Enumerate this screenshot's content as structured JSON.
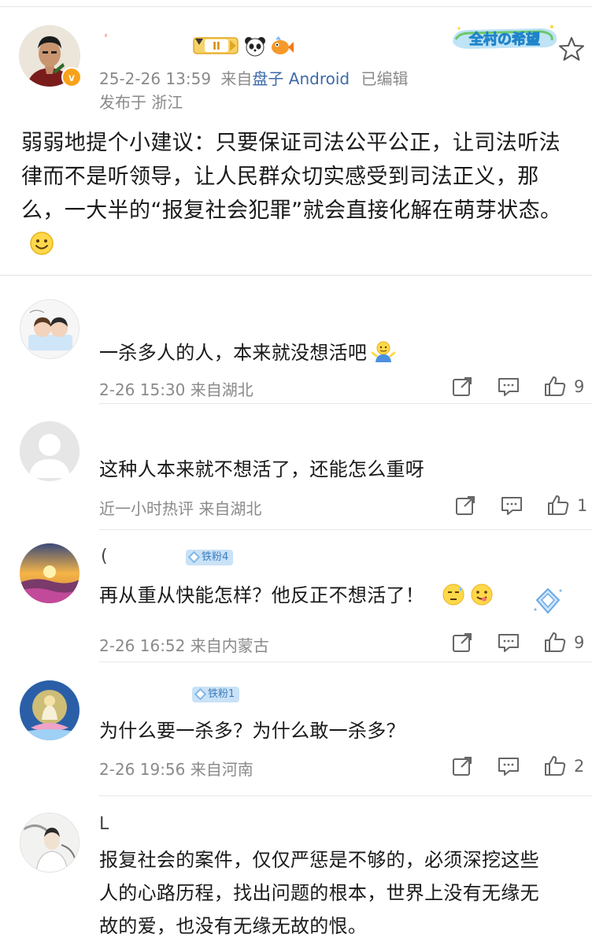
{
  "post": {
    "time": "25-2-26 13:59",
    "source_prefix": "来自",
    "source_app": "盘子 Android",
    "edited": "已编辑",
    "location": "发布于 浙江",
    "level_badge": "II",
    "brand_logo_text": "全村の希望",
    "text": "弱弱地提个小建议：只要保证司法公平公正，让司法听法律而不是听领导，让人民群众切实感受到司法正义，那么，一大半的“报复社会犯罪”就会直接化解在萌芽状态。",
    "emoji": "smile-emoji"
  },
  "comments": [
    {
      "text": "一杀多人的人，本来就没想活吧",
      "meta": "2-26 15:30  来自湖北",
      "likes": "9",
      "emoji": "shrug-emoji",
      "avatar": "cartoon-couple-avatar"
    },
    {
      "text": "这种人本来就不想活了，还能怎么重呀",
      "meta": "近一小时热评  来自湖北",
      "likes": "1",
      "avatar": "default-avatar"
    },
    {
      "name_mark": "(",
      "badge": "铁粉4",
      "text": "再从重从快能怎样？他反正不想活了！",
      "meta": "2-26 16:52  来自内蒙古",
      "likes": "9",
      "emoji": [
        "sweat-emoji",
        "yum-emoji"
      ],
      "avatar": "sunset-avatar"
    },
    {
      "badge": "铁粉1",
      "text": "为什么要一杀多？为什么敢一杀多？",
      "meta": "2-26 19:56  来自河南",
      "likes": "2",
      "avatar": "buddha-avatar"
    },
    {
      "name_mark": "L",
      "text_lines": [
        "报复社会的案件，仅仅严惩是不够的，必须深挖这些",
        "人的心路历程，找出问题的根本，世界上没有无缘无",
        "故的爱，也没有无缘无故的恨。"
      ],
      "avatar": "ink-portrait-avatar"
    }
  ],
  "colors": {
    "link": "#3d6aa8",
    "meta": "#8a8a8a",
    "badge_bg": "#c9e2f6",
    "badge_text": "#3f7ec0",
    "vip": "#f7a21b"
  }
}
